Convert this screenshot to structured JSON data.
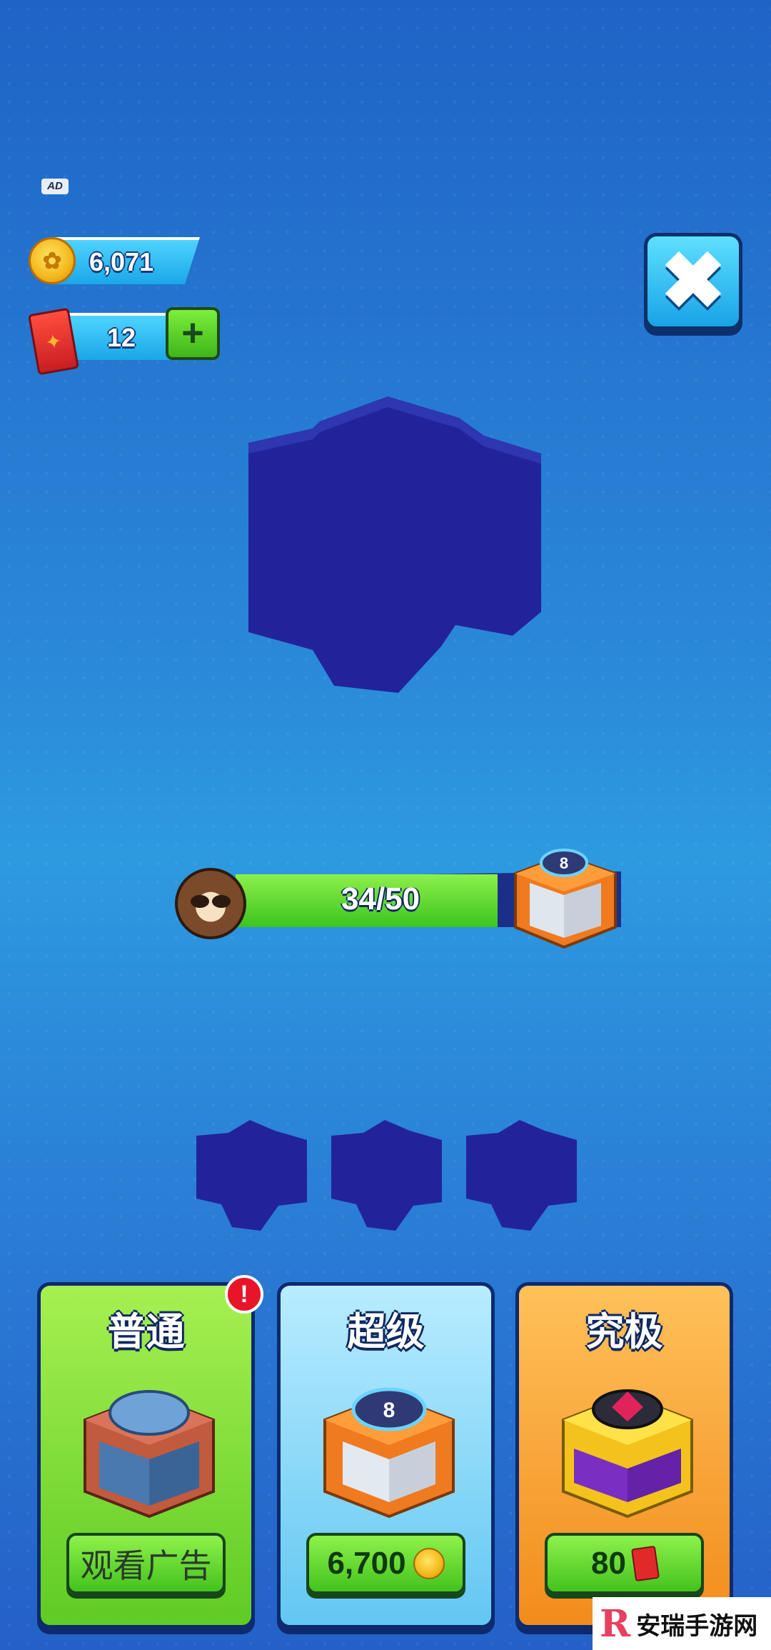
{
  "ad_badge": "AD",
  "currency": {
    "coins": "6,071",
    "tickets": "12",
    "plus_label": "+"
  },
  "close_label": "✖",
  "progress": {
    "text": "34/50",
    "current": 34,
    "max": 50
  },
  "cards": [
    {
      "title": "普通",
      "button": "观看广告",
      "alert": "!"
    },
    {
      "title": "超级",
      "button": "6,700"
    },
    {
      "title": "究极",
      "button": "80"
    }
  ],
  "watermark": {
    "logo": "R",
    "text": "安瑞手游网"
  },
  "colors": {
    "shadow_navy": "#22239a",
    "bg_blue": "#2a86d8"
  },
  "icons": [
    "coin-icon",
    "ticket-icon",
    "plus-icon",
    "close-icon",
    "raccoon-avatar",
    "chest-icon",
    "alert-icon"
  ]
}
